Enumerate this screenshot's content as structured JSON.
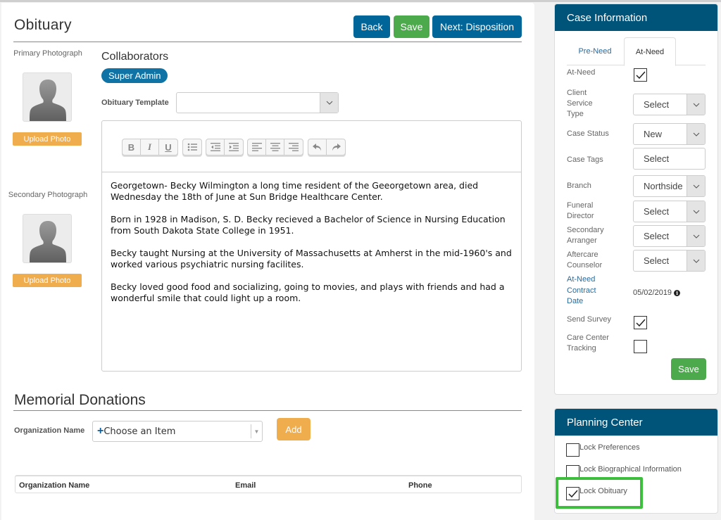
{
  "page": {
    "title": "Obituary",
    "buttons": {
      "back": "Back",
      "save": "Save",
      "next": "Next: Disposition"
    }
  },
  "photos": {
    "primary_label": "Primary Photograph",
    "secondary_label": "Secondary Photograph",
    "upload_label": "Upload Photo"
  },
  "collaborators": {
    "title": "Collaborators",
    "items": [
      "Super Admin"
    ]
  },
  "template": {
    "label": "Obituary Template",
    "value": ""
  },
  "editor": {
    "toolbar": {
      "bold": "B",
      "italic": "I",
      "underline": "U"
    },
    "paragraphs": [
      "Georgetown- Becky Wilmington a long time resident of the Geeorgetown area, died Wednesday the 18th of June at Sun Bridge Healthcare Center.",
      "Born in 1928 in Madison, S. D. Becky recieved a Bachelor of Science in Nursing Education from South Dakota State College in 1951.",
      "Becky taught Nursing at the University of Massachusetts at Amherst in the mid-1960's and worked various psychiatric nursing facilites.",
      "Becky loved good food and socializing, going to movies, and plays with friends and had a wonderful smile that could light up a room."
    ]
  },
  "donations": {
    "title": "Memorial Donations",
    "org_label": "Organization Name",
    "org_placeholder": "Choose an Item",
    "add_label": "Add",
    "columns": [
      "Organization Name",
      "Email",
      "Phone"
    ],
    "rows": []
  },
  "case_info": {
    "title": "Case Information",
    "tabs": [
      {
        "label": "Pre-Need",
        "active": false
      },
      {
        "label": "At-Need",
        "active": true
      }
    ],
    "fields": {
      "at_need": {
        "label": "At-Need",
        "checked": true
      },
      "client_service_type": {
        "label": "Client Service Type",
        "value": "Select"
      },
      "case_status": {
        "label": "Case Status",
        "value": "New"
      },
      "case_tags": {
        "label": "Case Tags",
        "value": "Select"
      },
      "branch": {
        "label": "Branch",
        "value": "Northside"
      },
      "funeral_director": {
        "label": "Funeral Director",
        "value": "Select"
      },
      "secondary_arranger": {
        "label": "Secondary Arranger",
        "value": "Select"
      },
      "aftercare_counselor": {
        "label": "Aftercare Counselor",
        "value": "Select"
      },
      "contract_date": {
        "label": "At-Need Contract Date",
        "value": "05/02/2019"
      },
      "send_survey": {
        "label": "Send Survey",
        "checked": true
      },
      "care_center_tracking": {
        "label": "Care Center Tracking",
        "checked": false
      }
    },
    "save_label": "Save"
  },
  "planning_center": {
    "title": "Planning Center",
    "items": [
      {
        "label": "Lock Preferences",
        "checked": false
      },
      {
        "label": "Lock Biographical Information",
        "checked": false
      },
      {
        "label": "Lock Obituary",
        "checked": true
      }
    ]
  },
  "colors": {
    "primary_blue": "#006699",
    "header_blue": "#00547a",
    "green": "#4caa4c",
    "orange": "#f0ad4e",
    "highlight_green": "#3dbf3d"
  }
}
